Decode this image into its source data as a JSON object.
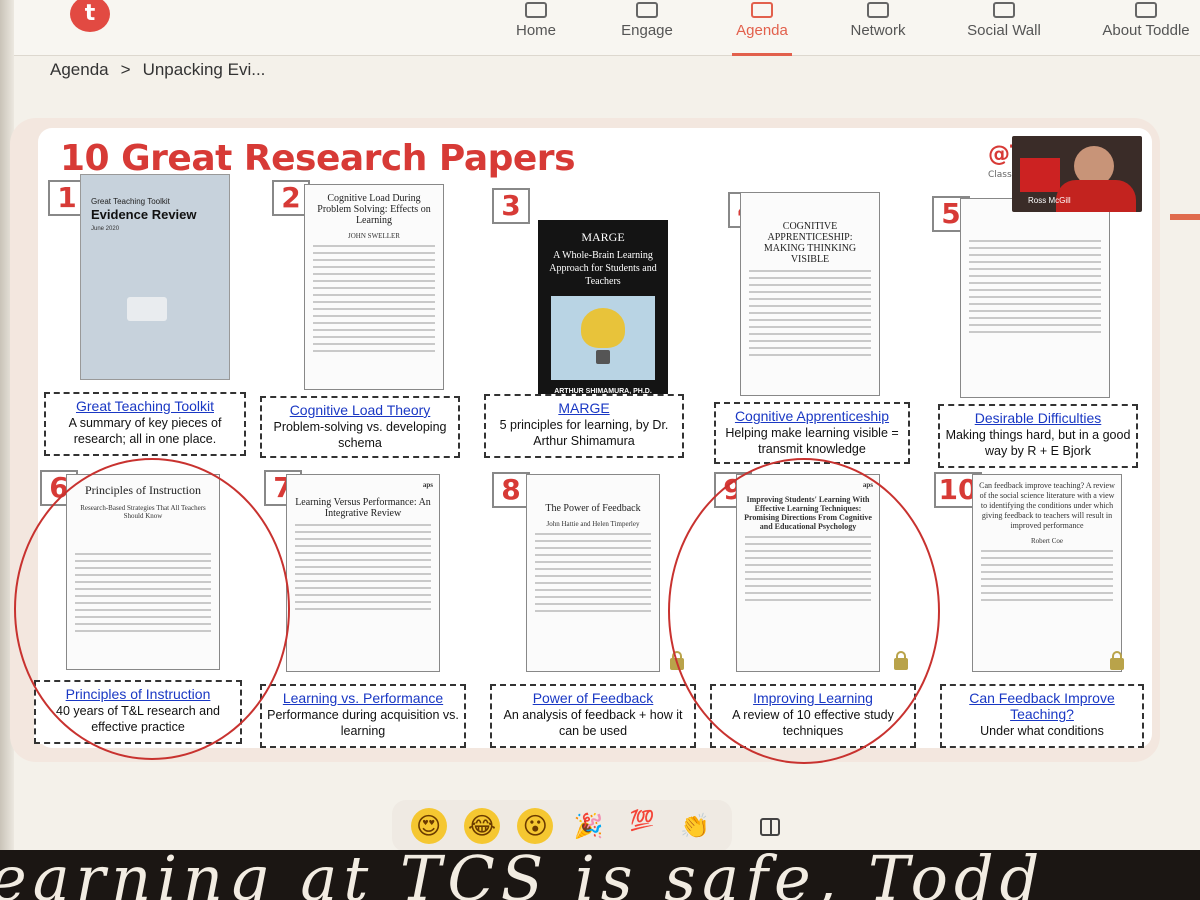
{
  "nav": {
    "logo": "t",
    "items": [
      {
        "label": "Home",
        "icon": "home-icon",
        "active": false
      },
      {
        "label": "Engage",
        "icon": "engage-icon",
        "active": false
      },
      {
        "label": "Agenda",
        "icon": "calendar-icon",
        "active": true
      },
      {
        "label": "Network",
        "icon": "sofa-icon",
        "active": false
      },
      {
        "label": "Social Wall",
        "icon": "shapes-icon",
        "active": false
      },
      {
        "label": "About Toddle",
        "icon": "building-icon",
        "active": false
      }
    ],
    "accent_color": "#e2604c"
  },
  "breadcrumb": {
    "root": "Agenda",
    "separator": ">",
    "current": "Unpacking Evi..."
  },
  "slide": {
    "title": "10 Great Research Papers",
    "handle": "@Tea",
    "handle_sub": "Classroom Idea",
    "title_color": "#d73a36",
    "webcam_name": "Ross McGill",
    "papers": [
      {
        "number": "1",
        "link": "Great Teaching Toolkit",
        "desc": "A summary of key pieces of research; all in one place.",
        "cover_title": "Evidence Review",
        "cover_kicker": "Great Teaching Toolkit",
        "cover_date": "June 2020"
      },
      {
        "number": "2",
        "link": "Cognitive Load Theory",
        "desc": "Problem-solving vs. developing schema",
        "cover_title": "Cognitive Load During Problem Solving: Effects on Learning",
        "cover_author": "JOHN SWELLER"
      },
      {
        "number": "3",
        "link": "MARGE",
        "desc": "5 principles for learning, by Dr. Arthur Shimamura",
        "cover_title": "MARGE",
        "cover_sub": "A Whole-Brain Learning Approach for Students and Teachers",
        "cover_author": "ARTHUR SHIMAMURA, PH.D."
      },
      {
        "number": "4",
        "link": "Cognitive Apprenticeship",
        "desc": "Helping make learning visible = transmit knowledge",
        "cover_title": "COGNITIVE APPRENTICESHIP: MAKING THINKING VISIBLE"
      },
      {
        "number": "5",
        "link": "Desirable Difficulties",
        "desc": "Making things hard, but in a good way by R + E Bjork"
      },
      {
        "number": "6",
        "link": "Principles of Instruction",
        "desc": "40 years of T&L research and effective practice",
        "cover_title": "Principles of Instruction",
        "cover_sub": "Research-Based Strategies That All Teachers Should Know"
      },
      {
        "number": "7",
        "link": "Learning vs. Performance",
        "desc": "Performance during acquisition vs. learning",
        "cover_title": "Learning Versus Performance: An Integrative Review",
        "cover_badge": "aps"
      },
      {
        "number": "8",
        "link": "Power of Feedback",
        "desc": "An analysis of feedback + how it can be used",
        "cover_title": "The Power of Feedback",
        "cover_author": "John Hattie and Helen Timperley"
      },
      {
        "number": "9",
        "link": "Improving Learning",
        "desc": "A review of 10 effective study techniques",
        "cover_title": "Improving Students' Learning With Effective Learning Techniques: Promising Directions From Cognitive and Educational Psychology",
        "cover_badge": "aps"
      },
      {
        "number": "10",
        "link": "Can Feedback Improve Teaching?",
        "desc": "Under what conditions",
        "cover_title": "Can feedback improve teaching? A review of the social science literature with a view to identifying the conditions under which giving feedback to teachers will result in improved performance",
        "cover_author": "Robert Coe"
      }
    ]
  },
  "reactions": [
    {
      "icon": "heart-eyes-emoji",
      "glyph": "😍"
    },
    {
      "icon": "laughing-emoji",
      "glyph": "😂"
    },
    {
      "icon": "surprised-emoji",
      "glyph": "😮"
    },
    {
      "icon": "party-popper-emoji",
      "glyph": "🎉"
    },
    {
      "icon": "hundred-emoji",
      "glyph": "💯"
    },
    {
      "icon": "clapping-emoji",
      "glyph": "👏"
    }
  ]
}
